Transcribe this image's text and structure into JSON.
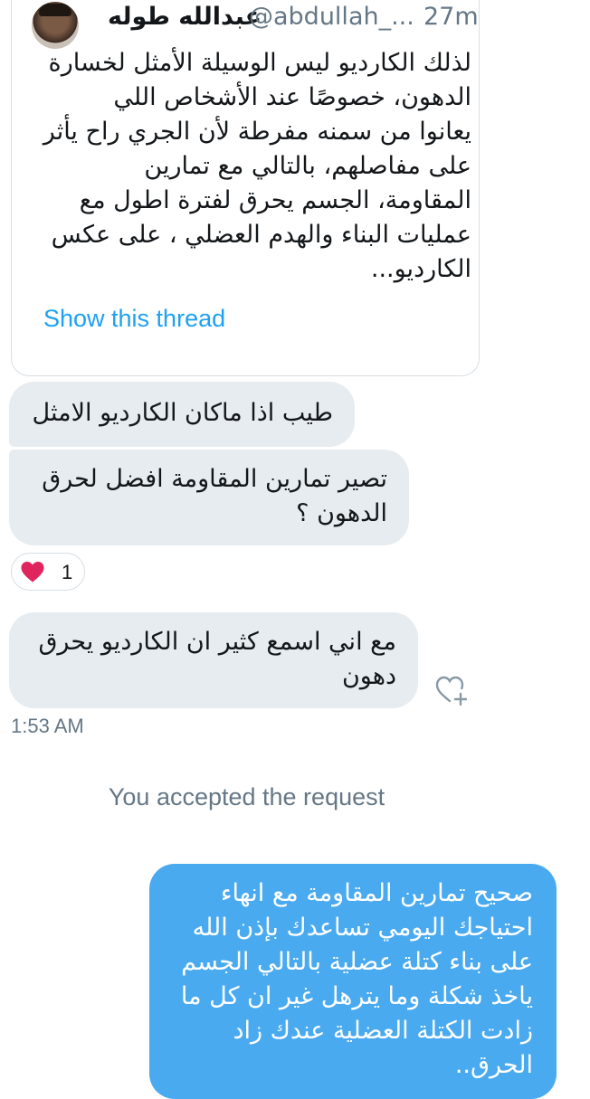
{
  "tweet": {
    "author_name": "عبدالله طوله",
    "handle": "@abdullah_...",
    "time_ago": "27m",
    "text_lines": [
      "لذلك الكارديو ليس الوسيلة الأمثل لخسارة",
      "الدهون، خصوصًا عند الأشخاص اللي",
      "يعانوا من سمنه مفرطة لأن الجري راح يأثر",
      "على مفاصلهم، بالتالي مع تمارين",
      "المقاومة، الجسم يحرق لفترة اطول مع",
      "عمليات البناء والهدم العضلي ، على عكس",
      "الكارديو..."
    ],
    "show_thread": "Show this thread"
  },
  "messages": {
    "m1": [
      "طيب اذا ماكان الكارديو الامثل"
    ],
    "m2": [
      "تصير تمارين المقاومة افضل لحرق",
      "الدهون ؟"
    ],
    "reaction": {
      "emoji": "heart",
      "count": "1",
      "color": "#e0245e"
    },
    "m3": [
      "مع اني اسمع كثير ان الكارديو يحرق",
      "دهون"
    ],
    "time": "1:53 AM",
    "system": "You accepted the request",
    "reply": [
      "صحيح تمارين المقاومة مع انهاء",
      "احتياجك اليومي تساعدك بإذن الله",
      "على بناء كتلة عضلية بالتالي الجسم",
      "ياخذ شكلة وما يترهل غير ان كل ما",
      "زادت الكتلة العضلية عندك زاد",
      "الحرق.."
    ]
  },
  "colors": {
    "accent": "#1da1f2",
    "outgoing": "#4aaaf0",
    "incoming": "#e6ecf0"
  }
}
